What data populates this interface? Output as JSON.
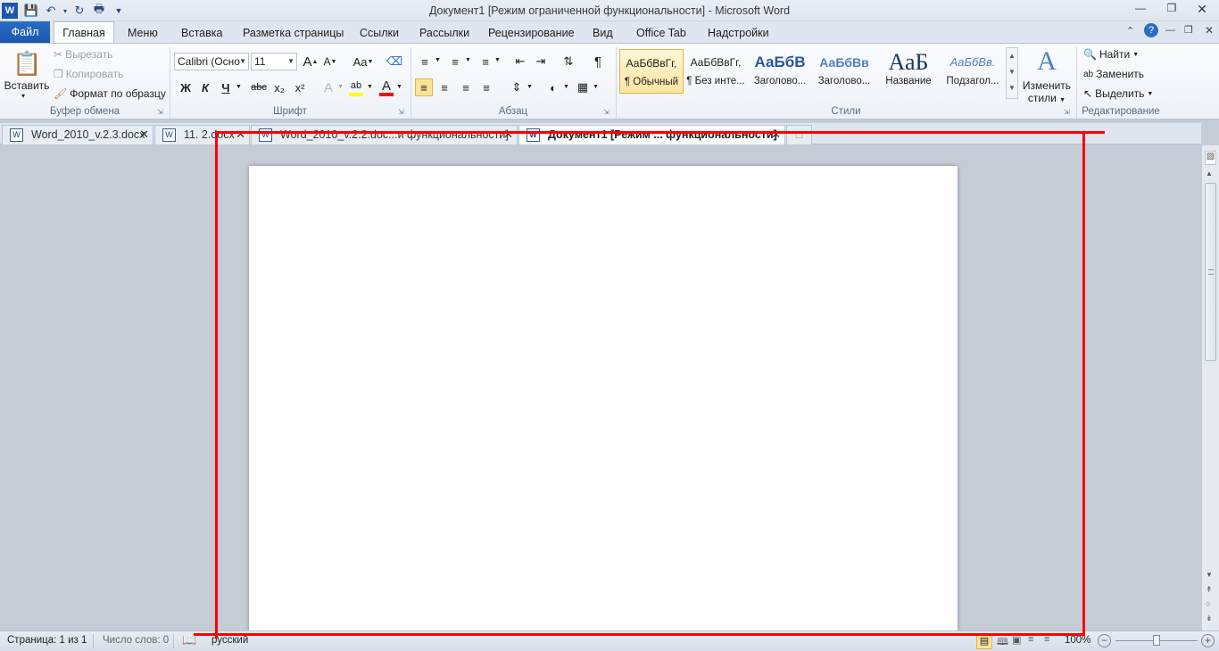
{
  "window": {
    "title": "Документ1 [Режим ограниченной функциональности]  -  Microsoft Word"
  },
  "ribbon_tabs": [
    "Файл",
    "Главная",
    "Меню",
    "Вставка",
    "Разметка страницы",
    "Ссылки",
    "Рассылки",
    "Рецензирование",
    "Вид",
    "Office Tab",
    "Надстройки"
  ],
  "clipboard": {
    "paste": "Вставить",
    "cut": "Вырезать",
    "copy": "Копировать",
    "format_painter": "Формат по образцу",
    "group": "Буфер обмена"
  },
  "font": {
    "name": "Calibri (Осно",
    "size": "11",
    "bold": "Ж",
    "italic": "К",
    "underline": "Ч",
    "strike": "abc",
    "sub": "x₂",
    "sup": "x²",
    "grow": "A",
    "shrink": "A",
    "case": "Aa",
    "group": "Шрифт"
  },
  "paragraph": {
    "group": "Абзац",
    "pilcrow": "¶"
  },
  "styles": {
    "items": [
      {
        "preview": "АаБбВвГг,",
        "name": "¶ Обычный"
      },
      {
        "preview": "АаБбВвГг,",
        "name": "¶ Без инте..."
      },
      {
        "preview": "АаБбВ",
        "name": "Заголово..."
      },
      {
        "preview": "АаБбВв",
        "name": "Заголово..."
      },
      {
        "preview": "АаБ",
        "name": "Название"
      },
      {
        "preview": "АаБбВв.",
        "name": "Подзагол..."
      }
    ],
    "change_styles_1": "Изменить",
    "change_styles_2": "стили",
    "group": "Стили"
  },
  "editing": {
    "find": "Найти",
    "replace": "Заменить",
    "select": "Выделить",
    "group": "Редактирование"
  },
  "doc_tabs": [
    {
      "label": "Word_2010_v.2.3.docx"
    },
    {
      "label": "11. 2.docx"
    },
    {
      "label": "Word_2010_v.2.2.doc...и функциональности]"
    },
    {
      "label": "Документ1 [Режим ... функциональности]"
    }
  ],
  "status": {
    "page": "Страница: 1 из 1",
    "words": "Число слов: 0",
    "language": "русский",
    "zoom": "100%"
  },
  "colors": {
    "accent": "#1a57b0",
    "highlight": "#ffff00",
    "font_color": "#ff0000",
    "annotation": "#ff0000"
  }
}
